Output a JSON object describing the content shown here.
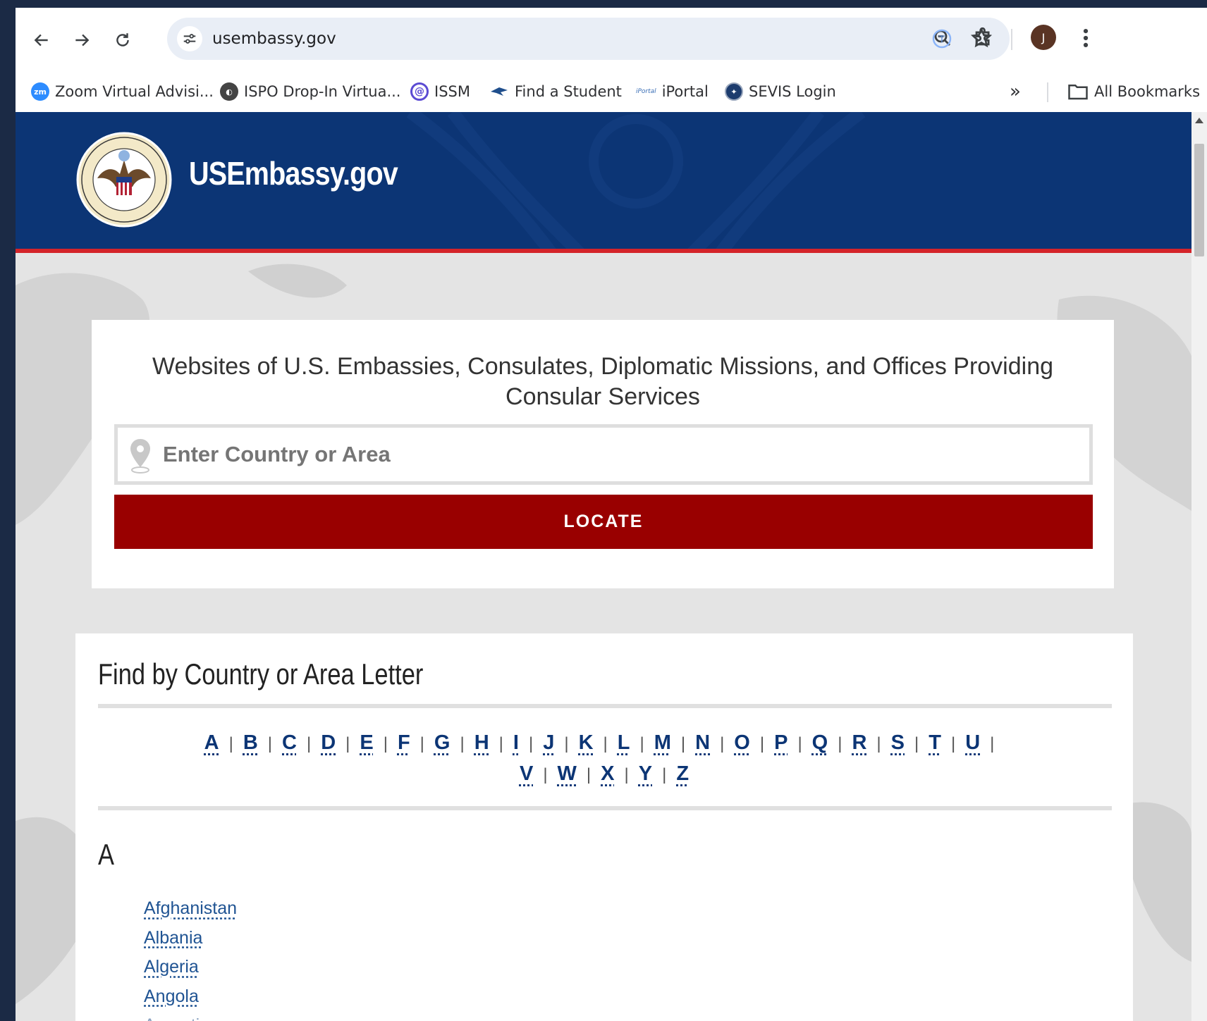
{
  "browser": {
    "url": "usembassy.gov",
    "profile_initial": "J",
    "bookmarks": [
      {
        "label": "Zoom Virtual Advisi...",
        "icon": "zoom-icon",
        "color": "#2d8cff"
      },
      {
        "label": "ISPO Drop-In Virtua...",
        "icon": "globe-icon",
        "color": "#444444"
      },
      {
        "label": "ISSM",
        "icon": "issm-icon",
        "color": "#5b4bd3"
      },
      {
        "label": "Find a Student",
        "icon": "bird-icon",
        "color": "#1f4e8c"
      },
      {
        "label": "iPortal",
        "icon": "iportal-icon",
        "color": "#3b6fb6"
      },
      {
        "label": "SEVIS Login",
        "icon": "dhs-seal-icon",
        "color": "#1d3c6e"
      }
    ],
    "all_bookmarks_label": "All Bookmarks",
    "overflow_label": "»"
  },
  "site": {
    "title": "USEmbassy.gov",
    "colors": {
      "header": "#0c3575",
      "accent_red": "#d4242a",
      "button": "#990000"
    }
  },
  "search": {
    "heading": "Websites of U.S. Embassies, Consulates, Diplomatic Missions, and Offices Providing Consular Services",
    "placeholder": "Enter Country or Area",
    "button_label": "LOCATE"
  },
  "letters": {
    "heading": "Find by Country or Area Letter",
    "items": [
      "A",
      "B",
      "C",
      "D",
      "E",
      "F",
      "G",
      "H",
      "I",
      "J",
      "K",
      "L",
      "M",
      "N",
      "O",
      "P",
      "Q",
      "R",
      "S",
      "T",
      "U",
      "V",
      "W",
      "X",
      "Y",
      "Z"
    ]
  },
  "section": {
    "letter": "A",
    "countries": [
      "Afghanistan",
      "Albania",
      "Algeria",
      "Angola",
      "Argentina"
    ]
  }
}
